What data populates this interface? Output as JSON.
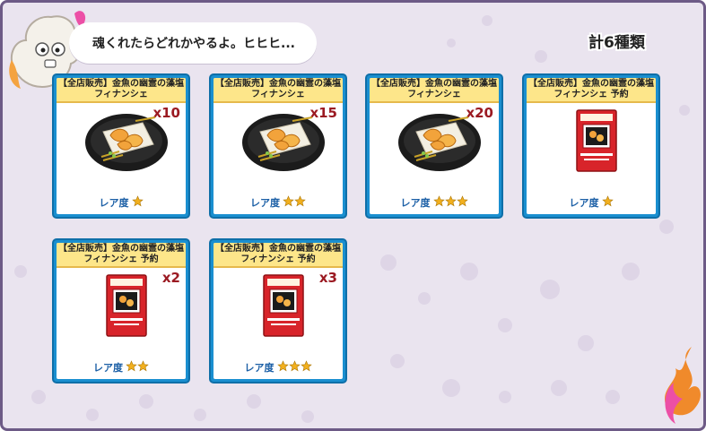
{
  "speech": "魂くれたらどれかやるよ。ヒヒヒ...",
  "count_label": "計6種類",
  "rarity_label": "レア度",
  "colors": {
    "card_border": "#1a8fd0",
    "title_band": "#fde68a",
    "quantity": "#9b1a22",
    "star": "#f2b01e"
  },
  "items": [
    {
      "title": "【全店販売】金魚の幽霊の藻塩フィナンシェ",
      "quantity": "x10",
      "stars": 1,
      "image": "financier-plate-icon"
    },
    {
      "title": "【全店販売】金魚の幽霊の藻塩フィナンシェ",
      "quantity": "x15",
      "stars": 2,
      "image": "financier-plate-icon"
    },
    {
      "title": "【全店販売】金魚の幽霊の藻塩フィナンシェ",
      "quantity": "x20",
      "stars": 3,
      "image": "financier-plate-icon"
    },
    {
      "title": "【全店販売】金魚の幽霊の藻塩フィナンシェ 予約",
      "quantity": "",
      "stars": 1,
      "image": "reservation-ticket-icon"
    },
    {
      "title": "【全店販売】金魚の幽霊の藻塩フィナンシェ 予約",
      "quantity": "x2",
      "stars": 2,
      "image": "reservation-ticket-icon"
    },
    {
      "title": "【全店販売】金魚の幽霊の藻塩フィナンシェ 予約",
      "quantity": "x3",
      "stars": 3,
      "image": "reservation-ticket-icon"
    }
  ]
}
